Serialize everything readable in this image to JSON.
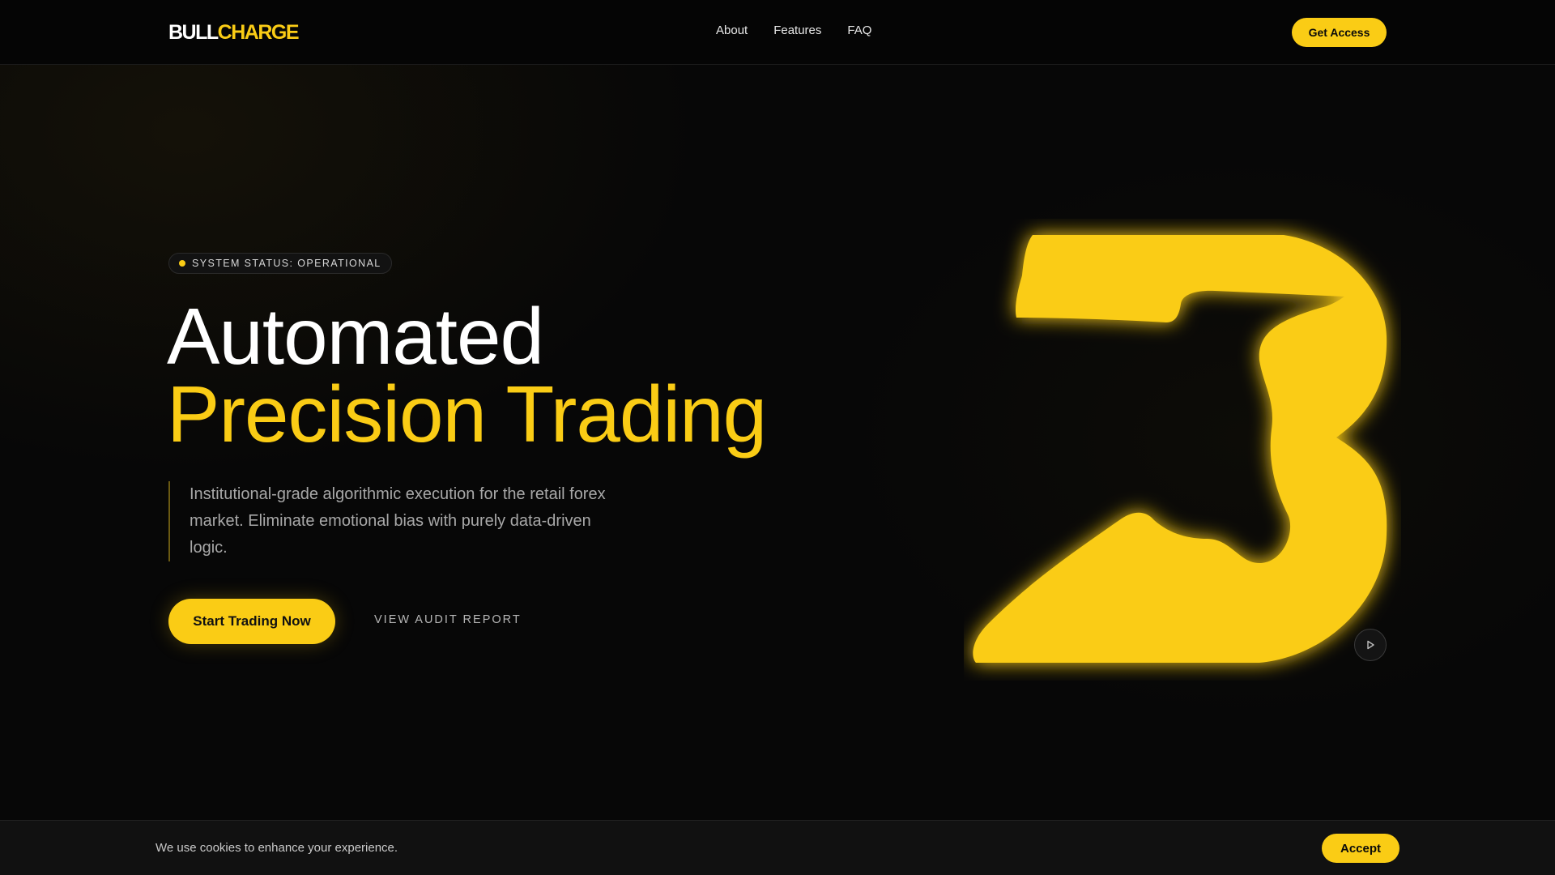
{
  "brand": {
    "logo_part1": "BULL",
    "logo_part2": "CHARGE"
  },
  "nav": {
    "items": [
      "About",
      "Features",
      "FAQ"
    ]
  },
  "header": {
    "cta_label": "Get Access"
  },
  "hero": {
    "status_text": "SYSTEM STATUS: OPERATIONAL",
    "title_line1": "Automated",
    "title_line2": "Precision Trading",
    "description": "Institutional-grade algorithmic execution for the retail forex market. Eliminate emotional bias with purely data-driven logic.",
    "primary_cta": "Start Trading Now",
    "secondary_cta": "VIEW AUDIT REPORT"
  },
  "cookie": {
    "text": "We use cookies to enhance your experience.",
    "accept_label": "Accept"
  },
  "colors": {
    "accent": "#facc15",
    "background": "#070707"
  },
  "icons": [
    "status-dot-icon",
    "play-icon",
    "numeral-graphic"
  ]
}
